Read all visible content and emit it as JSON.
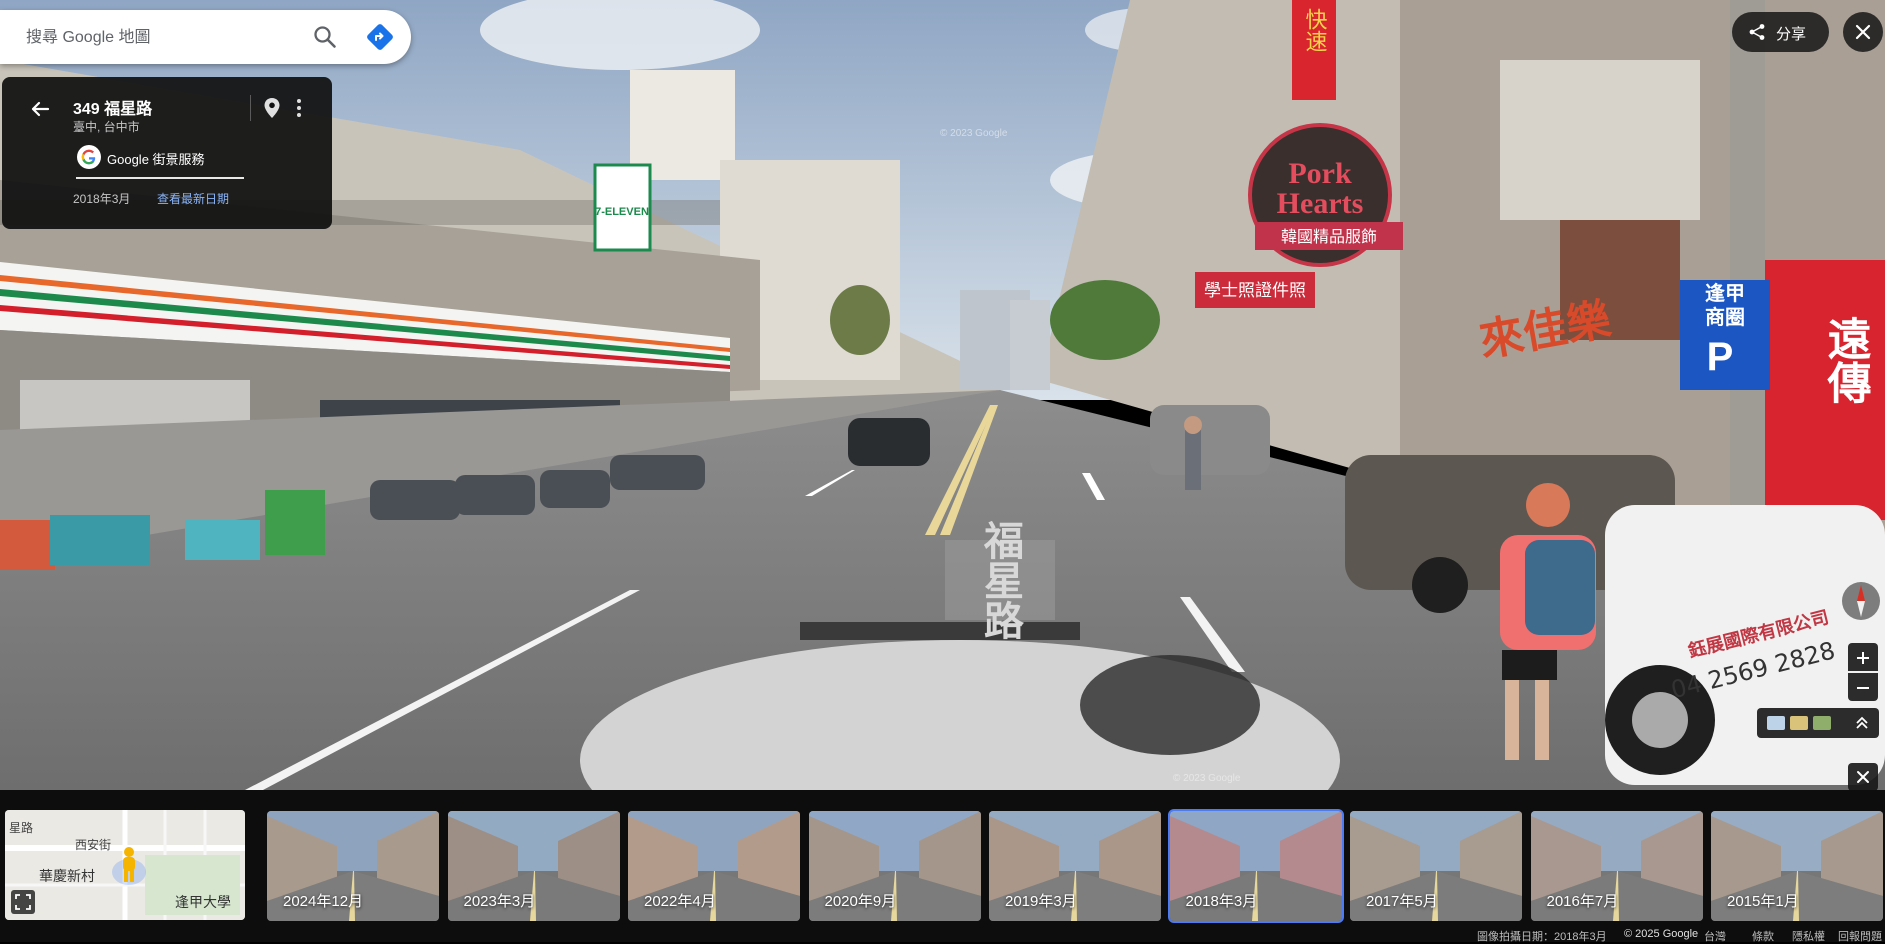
{
  "search": {
    "placeholder": "搜尋 Google 地圖"
  },
  "location": {
    "title": "349 福星路",
    "subtitle": "臺中, 台中市",
    "service_label": "Google 街景服務",
    "capture_date": "2018年3月",
    "latest_link": "查看最新日期"
  },
  "top_controls": {
    "share_label": "分享"
  },
  "scene_text": {
    "seven_eleven": "7-ELEVEN",
    "pork_hearts_1": "Pork",
    "pork_hearts_2": "Hearts",
    "korea_shop": "韓國精品服飾",
    "express": "快速",
    "fengjia_1": "逢甲",
    "fengjia_2": "商圈",
    "parking": "P",
    "road_paint": "福星路",
    "repair": "遠傳",
    "license": "學士照證件照",
    "company": "鈺展國際有限公司",
    "company_phone": "04 2569 2828",
    "happy_shop": "來佳樂",
    "watermark_1": "© 2023 Google",
    "watermark_2": "© 2023 Google"
  },
  "minimap": {
    "labels": [
      "星路",
      "西安街",
      "華慶新村",
      "逢甲大學"
    ]
  },
  "timeline": [
    {
      "label": "2024年12月",
      "selected": false
    },
    {
      "label": "2023年3月",
      "selected": false
    },
    {
      "label": "2022年4月",
      "selected": false
    },
    {
      "label": "2020年9月",
      "selected": false
    },
    {
      "label": "2019年3月",
      "selected": false
    },
    {
      "label": "2018年3月",
      "selected": true
    },
    {
      "label": "2017年5月",
      "selected": false
    },
    {
      "label": "2016年7月",
      "selected": false
    },
    {
      "label": "2015年1月",
      "selected": false
    }
  ],
  "footer": {
    "capture_date": "圖像拍攝日期：2018年3月",
    "copyright": "© 2025 Google",
    "region": "台灣",
    "terms": "條款",
    "privacy": "隱私權",
    "feedback": "回報問題"
  },
  "colors": {
    "accent_blue": "#4b7bf5",
    "link_blue": "#8ab4f8",
    "directions_blue": "#1a73e8",
    "pegman_yellow": "#f4b400"
  }
}
